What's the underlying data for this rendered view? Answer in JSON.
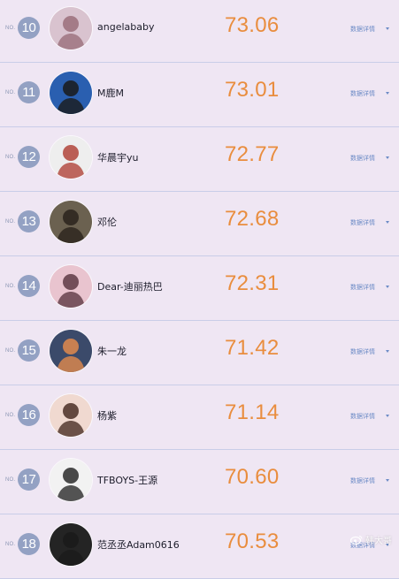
{
  "rows": [
    {
      "no_prefix": "NO.",
      "rank": "10",
      "name": "angelababy",
      "score": "73.06",
      "details_label": "数据详情",
      "avatar_icon": "avatar-photo",
      "colors": {
        "bg": "#d9c3cf",
        "fg": "#9a6f7a"
      }
    },
    {
      "no_prefix": "NO.",
      "rank": "11",
      "name": "M鹿M",
      "score": "73.01",
      "details_label": "数据详情",
      "avatar_icon": "avatar-photo",
      "colors": {
        "bg": "#2a5fb0",
        "fg": "#1a1a1a"
      }
    },
    {
      "no_prefix": "NO.",
      "rank": "12",
      "name": "华晨宇yu",
      "score": "72.77",
      "details_label": "数据详情",
      "avatar_icon": "avatar-photo",
      "colors": {
        "bg": "#eeeeee",
        "fg": "#b0443a"
      }
    },
    {
      "no_prefix": "NO.",
      "rank": "13",
      "name": "邓伦",
      "score": "72.68",
      "details_label": "数据详情",
      "avatar_icon": "avatar-photo",
      "colors": {
        "bg": "#6b6150",
        "fg": "#2a231c"
      }
    },
    {
      "no_prefix": "NO.",
      "rank": "14",
      "name": "Dear-迪丽热巴",
      "score": "72.31",
      "details_label": "数据详情",
      "avatar_icon": "avatar-photo",
      "colors": {
        "bg": "#e9c4cf",
        "fg": "#5e3a44"
      }
    },
    {
      "no_prefix": "NO.",
      "rank": "15",
      "name": "朱一龙",
      "score": "71.42",
      "details_label": "数据详情",
      "avatar_icon": "avatar-photo",
      "colors": {
        "bg": "#3b4a6a",
        "fg": "#e28a4c"
      }
    },
    {
      "no_prefix": "NO.",
      "rank": "16",
      "name": "杨紫",
      "score": "71.14",
      "details_label": "数据详情",
      "avatar_icon": "avatar-photo",
      "colors": {
        "bg": "#f0d9d0",
        "fg": "#4a2e26"
      }
    },
    {
      "no_prefix": "NO.",
      "rank": "17",
      "name": "TFBOYS-王源",
      "score": "70.60",
      "details_label": "数据详情",
      "avatar_icon": "avatar-photo",
      "colors": {
        "bg": "#f2f2f2",
        "fg": "#2b2b2b"
      }
    },
    {
      "no_prefix": "NO.",
      "rank": "18",
      "name": "范丞丞Adam0616",
      "score": "70.53",
      "details_label": "数据详情",
      "avatar_icon": "avatar-photo",
      "colors": {
        "bg": "#242424",
        "fg": "#1a1a1a"
      }
    }
  ],
  "watermark": {
    "text": "韩大哥",
    "icon": "weibo-icon"
  },
  "theme": {
    "background": "#efe6f3",
    "score_color": "#e98d3e",
    "rank_badge": "#93a1c3",
    "link_color": "#6c8bc6",
    "divider": "#c9cde8"
  }
}
